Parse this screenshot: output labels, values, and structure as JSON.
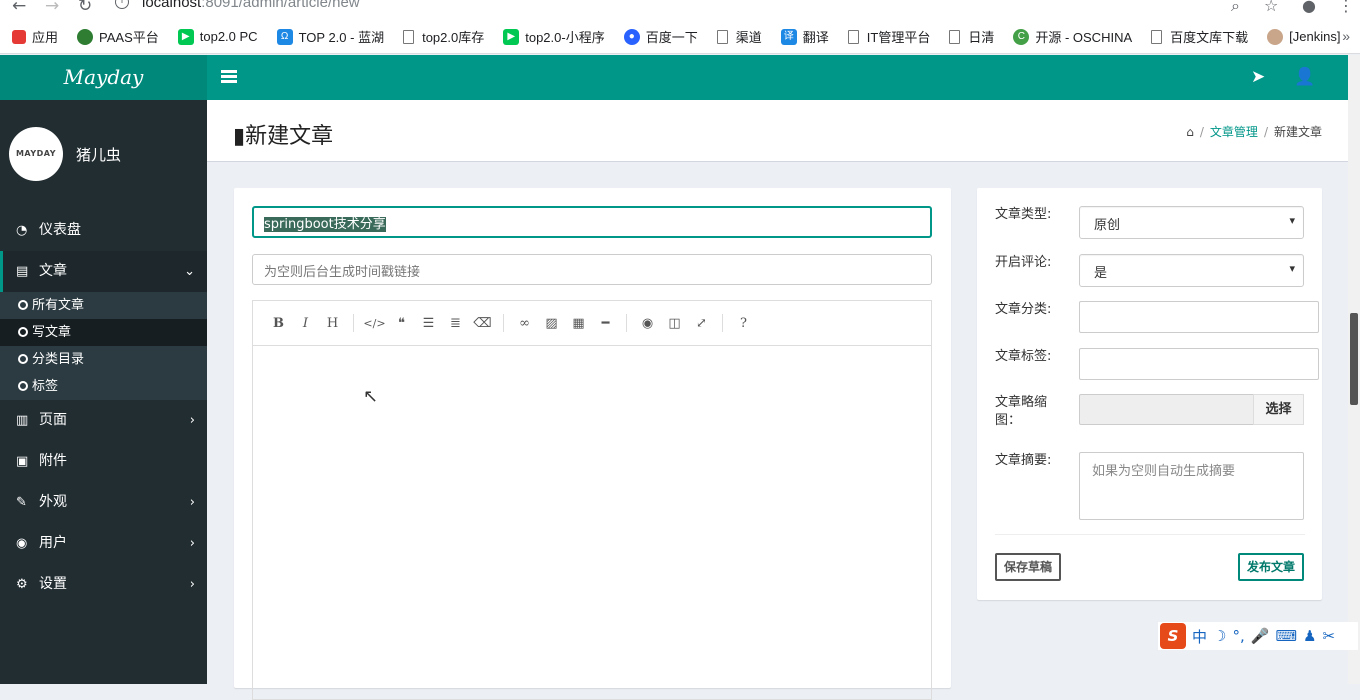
{
  "browser": {
    "url_host": "localhost",
    "url_rest": ":8091/admin/article/new",
    "bookmarks": [
      {
        "label": "应用",
        "icon": "apps-grid-icon",
        "color": "#e53935"
      },
      {
        "label": "PAAS平台",
        "icon": "paas-icon",
        "color": "#2e7d32"
      },
      {
        "label": "top2.0 PC",
        "icon": "play-icon",
        "color": "#00c853"
      },
      {
        "label": "TOP 2.0 - 蓝湖",
        "icon": "lanhu-icon",
        "color": "#1e88e5"
      },
      {
        "label": "top2.0库存",
        "icon": "page-icon",
        "color": ""
      },
      {
        "label": "top2.0-小程序",
        "icon": "play-icon",
        "color": "#00c853"
      },
      {
        "label": "百度一下",
        "icon": "baidu-icon",
        "color": "#2962ff"
      },
      {
        "label": "渠道",
        "icon": "page-icon",
        "color": ""
      },
      {
        "label": "翻译",
        "icon": "translate-icon",
        "color": "#1e88e5"
      },
      {
        "label": "IT管理平台",
        "icon": "page-icon",
        "color": ""
      },
      {
        "label": "日清",
        "icon": "page-icon",
        "color": ""
      },
      {
        "label": "开源 - OSCHINA",
        "icon": "oschina-icon",
        "color": "#43a047"
      },
      {
        "label": "百度文库下载",
        "icon": "page-icon",
        "color": ""
      },
      {
        "label": "[Jenkins]",
        "icon": "jenkins-icon",
        "color": "#c62828"
      }
    ],
    "more": "»"
  },
  "app": {
    "logo": "Mayday",
    "avatar_text": "MAYDAY",
    "user_name": "猪儿虫"
  },
  "sidebar": {
    "items": [
      {
        "label": "仪表盘",
        "icon": "dashboard-icon"
      },
      {
        "label": "文章",
        "icon": "book-icon"
      },
      {
        "label": "页面",
        "icon": "file-icon"
      },
      {
        "label": "附件",
        "icon": "image-icon"
      },
      {
        "label": "外观",
        "icon": "brush-icon"
      },
      {
        "label": "用户",
        "icon": "user-circle-icon"
      },
      {
        "label": "设置",
        "icon": "cog-icon"
      }
    ],
    "sub_items": [
      "所有文章",
      "写文章",
      "分类目录",
      "标签"
    ]
  },
  "page": {
    "title": "新建文章",
    "breadcrumb": {
      "section": "文章管理",
      "current": "新建文章"
    }
  },
  "editor": {
    "title_value": "springboot技术分享",
    "slug_placeholder": "为空则后台生成时间戳链接"
  },
  "settings": {
    "type_label": "文章类型:",
    "type_value": "原创",
    "comment_label": "开启评论:",
    "comment_value": "是",
    "category_label": "文章分类:",
    "tags_label": "文章标签:",
    "thumb_label": "文章略缩图：",
    "pick_label": "选择",
    "summary_label": "文章摘要:",
    "summary_placeholder": "如果为空则自动生成摘要",
    "save_draft": "保存草稿",
    "publish": "发布文章"
  },
  "colors": {
    "accent": "#009688",
    "sidebar": "#222d32"
  }
}
